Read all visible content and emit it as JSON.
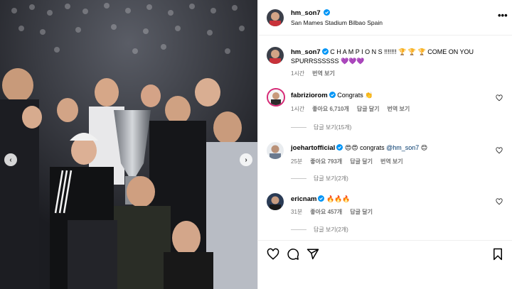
{
  "post": {
    "username": "hm_son7",
    "location": "San Mames Stadium Bilbao Spain"
  },
  "caption": {
    "username": "hm_son7",
    "text": "C H A M P I O N S !!!!!!! 🏆 🏆 🏆 COME ON YOU SPURRSSSSSS 💜💜💜",
    "time": "1시간",
    "translate": "번역 보기"
  },
  "comments": [
    {
      "username": "fabriziorom",
      "text": "Congrats 👏",
      "time": "1시간",
      "likes": "좋아요 6,710개",
      "reply": "답글 달기",
      "translate": "번역 보기",
      "view_replies": "답글 보기(15개)"
    },
    {
      "username": "joehartofficial",
      "text_prefix": "😍😍 congrats ",
      "mention": "@hm_son7",
      "text_suffix": " 😊",
      "time": "25분",
      "likes": "좋아요 793개",
      "reply": "답글 달기",
      "translate": "번역 보기",
      "view_replies": "답글 보기(2개)"
    },
    {
      "username": "ericnam",
      "text": "🔥🔥🔥",
      "time": "31분",
      "likes": "좋아요 457개",
      "reply": "답글 달기",
      "view_replies": "답글 보기(2개)"
    }
  ],
  "icons": [
    "more-icon",
    "heart-icon",
    "comment-icon",
    "share-icon",
    "bookmark-icon",
    "chevron-left-icon",
    "chevron-right-icon",
    "verified-icon"
  ],
  "colors": {
    "verified": "#0095f6",
    "muted": "#737373",
    "link": "#00376b"
  }
}
